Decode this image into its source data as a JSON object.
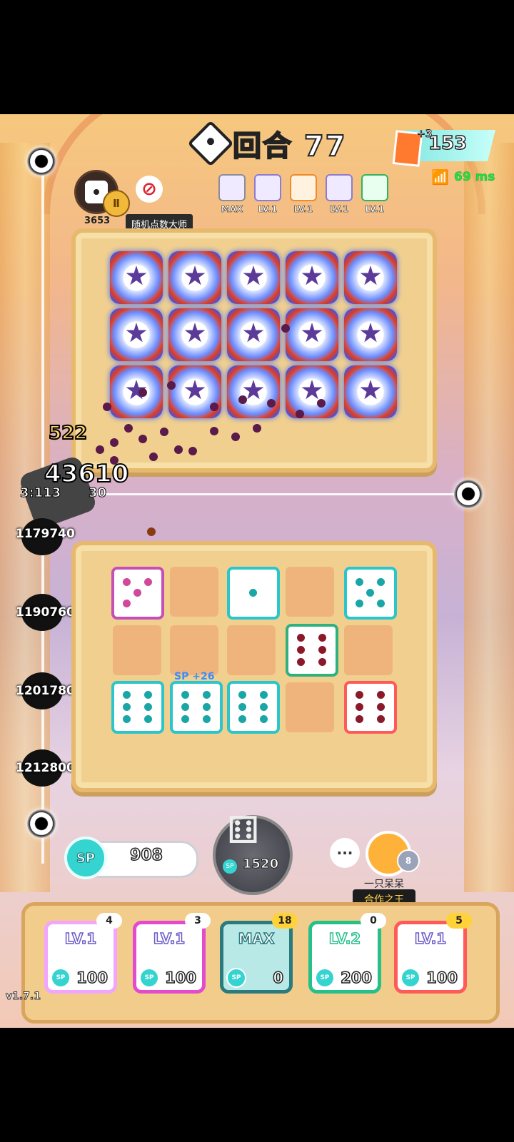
{
  "header": {
    "round_label": "回合 77",
    "sp_top": "153",
    "card_bonus": "+3",
    "ping": "69 ms",
    "player_trophies": "3653",
    "player_title": "随机点数大师"
  },
  "mini_decks": [
    {
      "level": "MAX"
    },
    {
      "level": "LV.1"
    },
    {
      "level": "LV.1"
    },
    {
      "level": "LV.1"
    },
    {
      "level": "LV.1"
    }
  ],
  "damage": {
    "combo": "522",
    "big_hit": "43610",
    "boss_hp": "3:113",
    "boss_hp_suffix": "30"
  },
  "waves": [
    "1179740",
    "1190760",
    "1201780",
    "1212800"
  ],
  "sp_popup": "SP +26",
  "controls": {
    "sp_label": "SP",
    "sp_amount": "908",
    "summon_cost": "1520",
    "chat": "···"
  },
  "partner": {
    "name": "一只呆呆",
    "title": "合作之王",
    "rank": "8"
  },
  "deck": [
    {
      "level": "LV.1",
      "count": "4",
      "cost": "100",
      "color": "#f1a5ff"
    },
    {
      "level": "LV.1",
      "count": "3",
      "cost": "100",
      "color": "#e24ad0"
    },
    {
      "level": "MAX",
      "count": "18",
      "cost": "0",
      "color": "#2bc5cc"
    },
    {
      "level": "LV.2",
      "count": "0",
      "cost": "200",
      "color": "#26c08a"
    },
    {
      "level": "LV.1",
      "count": "5",
      "cost": "100",
      "color": "#ff5a5a"
    }
  ],
  "version": "v1.7.1",
  "icons": {
    "round": "dice-diamond-icon",
    "ban": "ban-icon",
    "wifi": "wifi-icon",
    "summon": "dice-pair-icon",
    "portal": "portal-icon"
  }
}
